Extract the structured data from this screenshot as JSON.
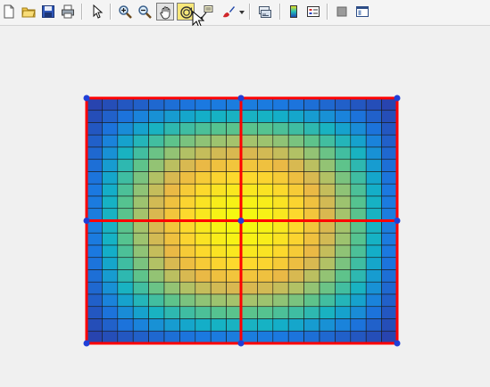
{
  "toolbar": {
    "buttons": [
      {
        "name": "new-figure-button",
        "icon": "new-document-icon"
      },
      {
        "name": "open-file-button",
        "icon": "folder-icon"
      },
      {
        "name": "save-figure-button",
        "icon": "floppy-disk-icon"
      },
      {
        "name": "print-figure-button",
        "icon": "printer-icon"
      },
      {
        "name": "edit-plot-button",
        "icon": "pointer-arrow-icon"
      },
      {
        "name": "zoom-in-button",
        "icon": "zoom-in-icon"
      },
      {
        "name": "zoom-out-button",
        "icon": "zoom-out-icon"
      },
      {
        "name": "pan-button",
        "icon": "hand-icon"
      },
      {
        "name": "rotate-3d-button",
        "icon": "rotate-icon"
      },
      {
        "name": "data-cursor-button",
        "icon": "data-cursor-icon"
      },
      {
        "name": "brush-button",
        "icon": "brush-icon"
      },
      {
        "name": "link-plot-button",
        "icon": "link-plot-icon"
      },
      {
        "name": "insert-colorbar-button",
        "icon": "colorbar-icon"
      },
      {
        "name": "insert-legend-button",
        "icon": "legend-icon"
      },
      {
        "name": "hide-plot-tools-button",
        "icon": "hide-tools-icon"
      },
      {
        "name": "show-plot-tools-button",
        "icon": "show-tools-icon"
      }
    ]
  },
  "surface": {
    "grid_rows": 20,
    "grid_cols": 20,
    "colormap": [
      "#2a3aa6",
      "#1b79e0",
      "#14b1c6",
      "#56c38f",
      "#a9c36a",
      "#e8b548",
      "#fdd72e",
      "#f5f810"
    ],
    "edge_color": "#1a1a1a",
    "mesh_line_color": "#ff0000",
    "control_point_color": "#1f3fd8"
  }
}
